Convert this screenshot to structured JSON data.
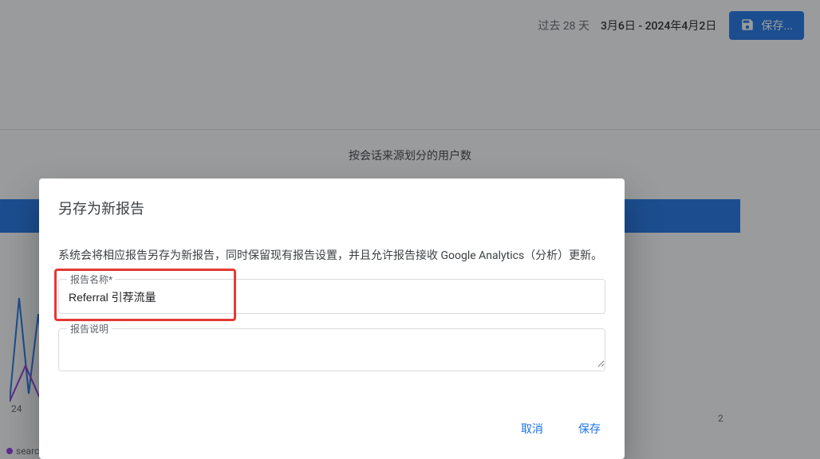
{
  "toolbar": {
    "date_range_prefix": "过去 28 天",
    "date_range_value": "3月6日 - 2024年4月2日",
    "save_label": "保存...",
    "save_icon": "save-icon"
  },
  "panel": {
    "title": "按会话来源划分的用户数"
  },
  "chart_data": {
    "type": "bar",
    "categories": [
      "search-dre.dt.dbankcloud.com"
    ],
    "values": [
      2
    ],
    "xlabel": "",
    "ylabel": "",
    "x_ticks": [
      "24",
      "2"
    ],
    "legend": [
      "search-dre.dt.dbankcloud.com"
    ],
    "legend_colors": [
      "#9334e6"
    ]
  },
  "dialog": {
    "title": "另存为新报告",
    "description": "系统会将相应报告另存为新报告，同时保留现有报告设置，并且允许报告接收 Google Analytics（分析）更新。",
    "name_label": "报告名称*",
    "name_value": "Referral 引荐流量",
    "desc_label": "报告说明",
    "desc_value": "",
    "cancel_label": "取消",
    "confirm_label": "保存"
  }
}
